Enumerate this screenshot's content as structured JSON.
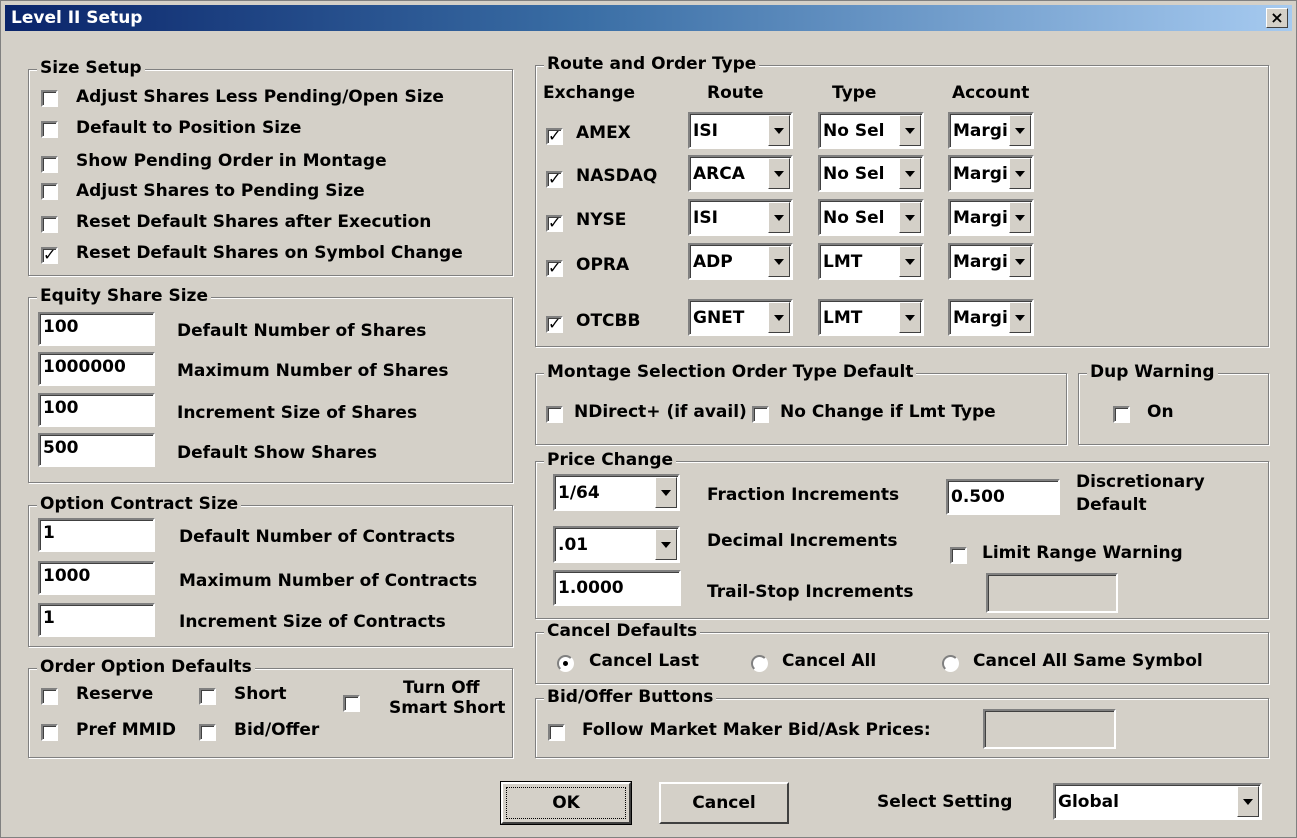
{
  "window": {
    "title": "Level II Setup",
    "close_glyph": "×"
  },
  "size_setup": {
    "title": "Size Setup",
    "items": [
      {
        "label": "Adjust Shares Less Pending/Open Size",
        "checked": false
      },
      {
        "label": "Default to Position Size",
        "checked": false
      },
      {
        "label": "Show Pending Order in Montage",
        "checked": false
      },
      {
        "label": "Adjust Shares to Pending Size",
        "checked": false
      },
      {
        "label": "Reset Default Shares after Execution",
        "checked": false
      },
      {
        "label": "Reset Default Shares on Symbol Change",
        "checked": true
      }
    ]
  },
  "equity": {
    "title": "Equity Share Size",
    "rows": [
      {
        "value": "100",
        "label": "Default Number of Shares"
      },
      {
        "value": "1000000",
        "label": "Maximum Number of Shares"
      },
      {
        "value": "100",
        "label": "Increment Size of Shares"
      },
      {
        "value": "500",
        "label": "Default Show Shares"
      }
    ]
  },
  "option": {
    "title": "Option Contract Size",
    "rows": [
      {
        "value": "1",
        "label": "Default Number of Contracts"
      },
      {
        "value": "1000",
        "label": "Maximum Number of Contracts"
      },
      {
        "value": "1",
        "label": "Increment Size of Contracts"
      }
    ]
  },
  "order_option": {
    "title": "Order Option Defaults",
    "reserve": "Reserve",
    "short": "Short",
    "turn_off_1": "Turn Off",
    "turn_off_2": "Smart Short",
    "pref_mmid": "Pref MMID",
    "bid_offer": "Bid/Offer"
  },
  "route": {
    "title": "Route and Order Type",
    "headers": {
      "exchange": "Exchange",
      "route": "Route",
      "type": "Type",
      "account": "Account"
    },
    "rows": [
      {
        "exchange": "AMEX",
        "checked": true,
        "route": "ISI",
        "type": "No Sel",
        "account": "Margin"
      },
      {
        "exchange": "NASDAQ",
        "checked": true,
        "route": "ARCA",
        "type": "No Sel",
        "account": "Margin"
      },
      {
        "exchange": "NYSE",
        "checked": true,
        "route": "ISI",
        "type": "No Sel",
        "account": "Margin"
      },
      {
        "exchange": "OPRA",
        "checked": true,
        "route": "ADP",
        "type": "LMT",
        "account": "Margin"
      },
      {
        "exchange": "OTCBB",
        "checked": true,
        "route": "GNET",
        "type": "LMT",
        "account": "Margin"
      }
    ]
  },
  "montage": {
    "title": "Montage Selection Order Type Default",
    "ndirect": "NDirect+ (if avail)",
    "no_change": "No Change if Lmt Type"
  },
  "dup": {
    "title": "Dup Warning",
    "on": "On"
  },
  "price": {
    "title": "Price Change",
    "fraction_value": "1/64",
    "fraction_label": "Fraction Increments",
    "decimal_value": ".01",
    "decimal_label": "Decimal Increments",
    "trail_value": "1.0000",
    "trail_label": "Trail-Stop Increments",
    "disc_value": "0.500",
    "disc_label_1": "Discretionary",
    "disc_label_2": "Default",
    "limit_label": "Limit Range Warning"
  },
  "cancel_defaults": {
    "title": "Cancel Defaults",
    "last": "Cancel Last",
    "all": "Cancel All",
    "all_same": "Cancel All Same Symbol",
    "selected": "last"
  },
  "bid_offer": {
    "title": "Bid/Offer Buttons",
    "follow": "Follow Market Maker Bid/Ask Prices:"
  },
  "footer": {
    "ok": "OK",
    "cancel": "Cancel",
    "select_setting_label": "Select Setting",
    "select_setting_value": "Global"
  }
}
